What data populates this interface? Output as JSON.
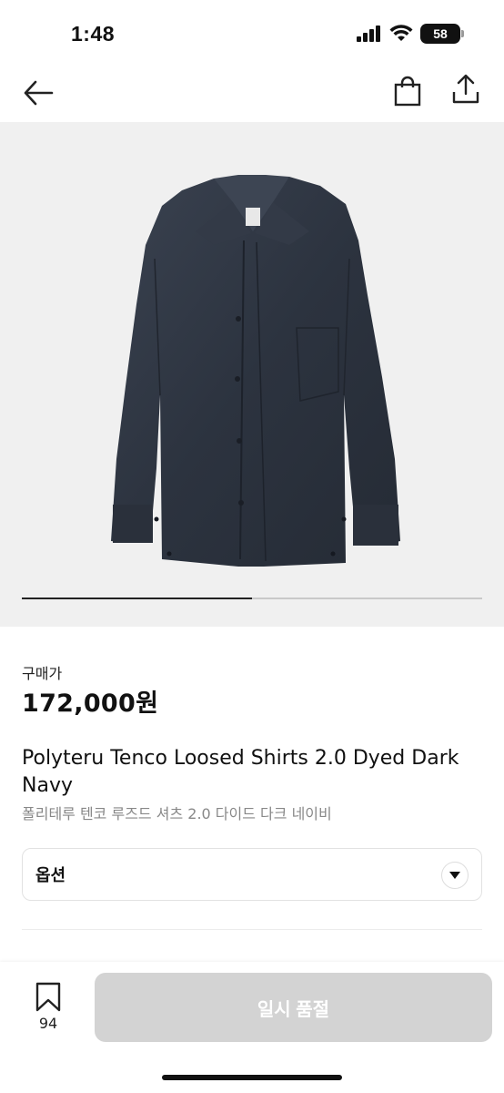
{
  "status_bar": {
    "time": "1:48",
    "battery": "58"
  },
  "nav": {
    "back_icon": "arrow-left-icon",
    "bag_icon": "shopping-bag-icon",
    "share_icon": "share-icon"
  },
  "gallery": {
    "image_alt": "dark navy shirt",
    "progress": 0.5,
    "accent_color": "#222222"
  },
  "price": {
    "label": "구매가",
    "value": "172,000원"
  },
  "product": {
    "name": "Polyteru Tenco Loosed Shirts 2.0 Dyed Dark Navy",
    "name_ko": "폴리테루 텐코 루즈드 셔츠 2.0 다이드 다크 네이비"
  },
  "option": {
    "label": "옵션",
    "icon": "chevron-down-icon"
  },
  "bottom_bar": {
    "wish_count": "94",
    "buy_label": "일시 품절",
    "buy_color": "#d3d3d3"
  }
}
